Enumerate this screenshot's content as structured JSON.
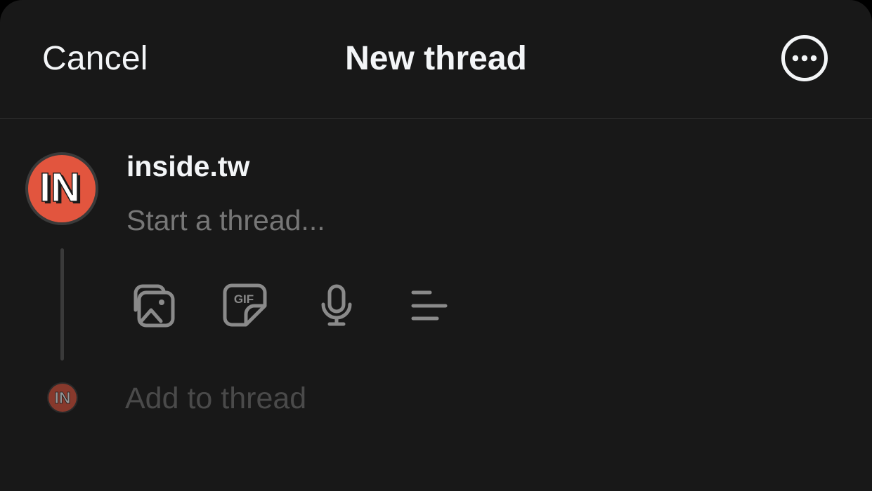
{
  "header": {
    "cancel_label": "Cancel",
    "title": "New thread",
    "more_icon": "more-options-icon"
  },
  "composer": {
    "avatar_text": "IN",
    "avatar_color": "#e2553e",
    "username": "inside.tw",
    "placeholder": "Start a thread...",
    "value": ""
  },
  "toolbar": {
    "icons": [
      "image-gallery-icon",
      "gif-icon",
      "microphone-icon",
      "poll-icon"
    ]
  },
  "add_to_thread": {
    "avatar_text": "IN",
    "placeholder": "Add to thread"
  },
  "colors": {
    "background": "#181818",
    "text_primary": "#f3f5f7",
    "text_secondary": "#777777",
    "text_disabled": "#4a4a4a",
    "divider": "#333333",
    "icon": "#8a8a8a"
  }
}
